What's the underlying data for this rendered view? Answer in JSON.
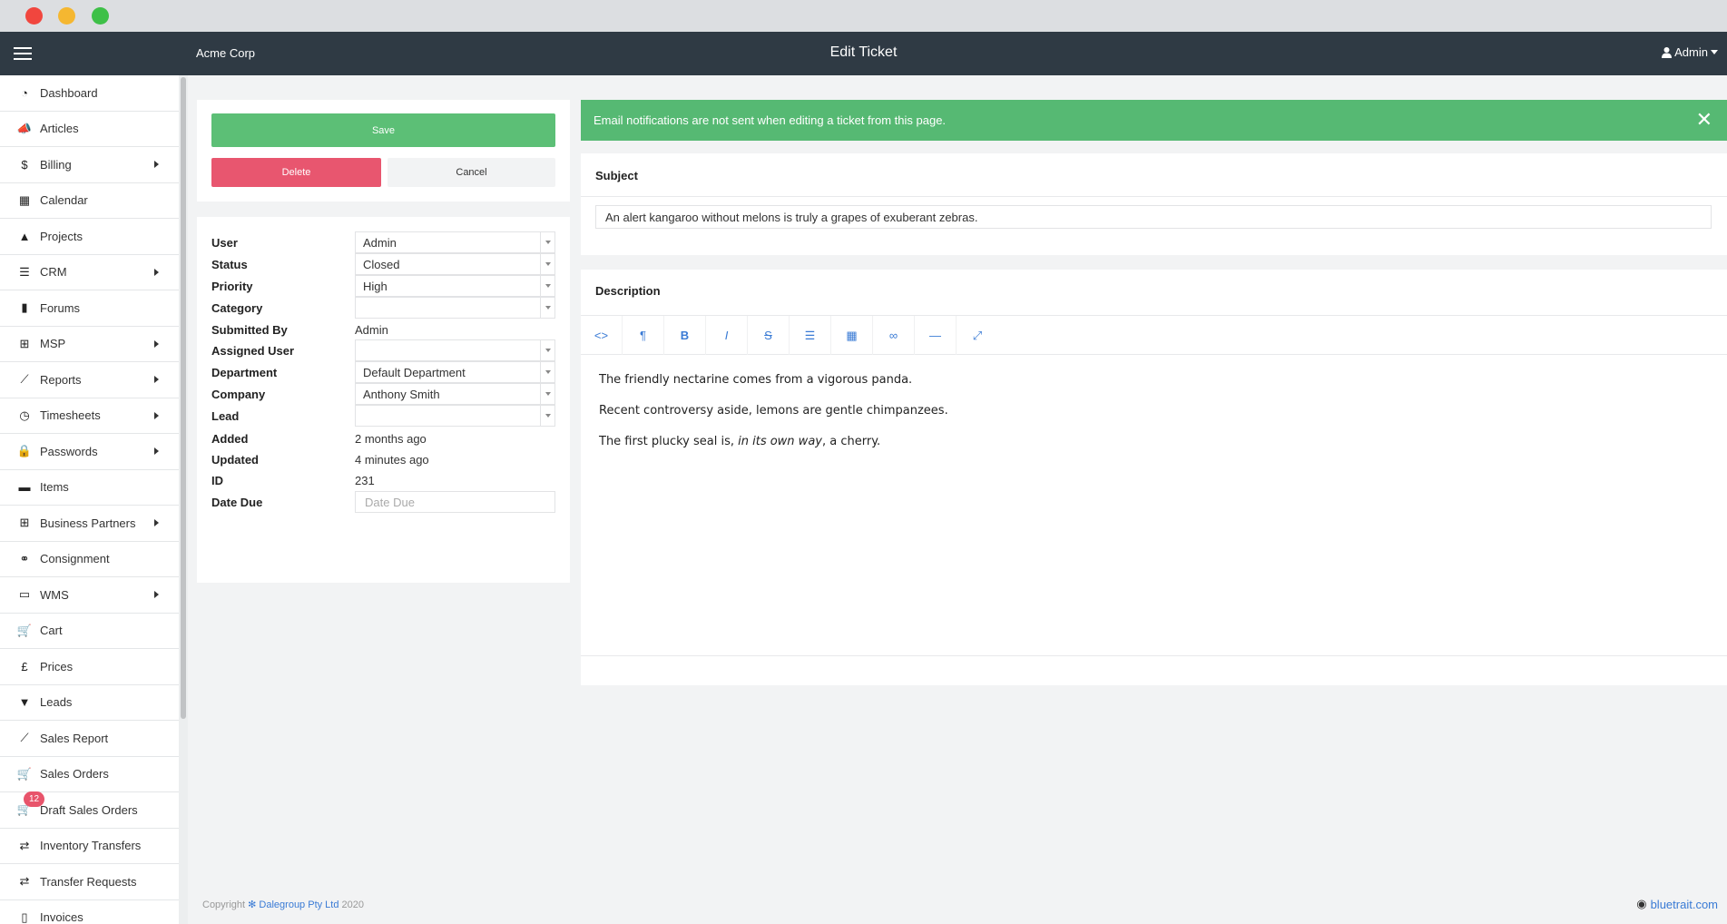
{
  "app": {
    "brand": "Acme Corp",
    "title": "Edit Ticket",
    "user_menu": "Admin"
  },
  "sidebar": {
    "items": [
      {
        "label": "Dashboard",
        "icon": "dashboard-icon",
        "glyph": "◔",
        "submenu": false
      },
      {
        "label": "Articles",
        "icon": "megaphone-icon",
        "glyph": "📣",
        "submenu": false
      },
      {
        "label": "Billing",
        "icon": "dollar-icon",
        "glyph": "$",
        "submenu": true
      },
      {
        "label": "Calendar",
        "icon": "calendar-icon",
        "glyph": "▦",
        "submenu": false
      },
      {
        "label": "Projects",
        "icon": "road-icon",
        "glyph": "▲",
        "submenu": false
      },
      {
        "label": "CRM",
        "icon": "list-alt-icon",
        "glyph": "☰",
        "submenu": true
      },
      {
        "label": "Forums",
        "icon": "book-icon",
        "glyph": "▮",
        "submenu": false
      },
      {
        "label": "MSP",
        "icon": "sitemap-icon",
        "glyph": "⊞",
        "submenu": true
      },
      {
        "label": "Reports",
        "icon": "line-chart-icon",
        "glyph": "⟋",
        "submenu": true
      },
      {
        "label": "Timesheets",
        "icon": "clock-icon",
        "glyph": "◷",
        "submenu": true
      },
      {
        "label": "Passwords",
        "icon": "lock-icon",
        "glyph": "🔒",
        "submenu": true
      },
      {
        "label": "Items",
        "icon": "archive-icon",
        "glyph": "▬",
        "submenu": false
      },
      {
        "label": "Business Partners",
        "icon": "sitemap-icon",
        "glyph": "⊞",
        "submenu": true
      },
      {
        "label": "Consignment",
        "icon": "handshake-icon",
        "glyph": "⚭",
        "submenu": false
      },
      {
        "label": "WMS",
        "icon": "truck-icon",
        "glyph": "▭",
        "submenu": true
      },
      {
        "label": "Cart",
        "icon": "cart-icon",
        "glyph": "🛒",
        "submenu": false
      },
      {
        "label": "Prices",
        "icon": "pound-icon",
        "glyph": "£",
        "submenu": false
      },
      {
        "label": "Leads",
        "icon": "funnel-dollar-icon",
        "glyph": "▼",
        "submenu": false
      },
      {
        "label": "Sales Report",
        "icon": "line-chart-icon",
        "glyph": "⟋",
        "submenu": false
      },
      {
        "label": "Sales Orders",
        "icon": "cart-icon",
        "glyph": "🛒",
        "submenu": false
      },
      {
        "label": "Draft Sales Orders",
        "icon": "cart-icon",
        "glyph": "🛒",
        "submenu": false,
        "badge": "12"
      },
      {
        "label": "Inventory Transfers",
        "icon": "exchange-icon",
        "glyph": "⇄",
        "submenu": false
      },
      {
        "label": "Transfer Requests",
        "icon": "exchange-icon",
        "glyph": "⇄",
        "submenu": false
      },
      {
        "label": "Invoices",
        "icon": "file-invoice-icon",
        "glyph": "▯",
        "submenu": false
      }
    ]
  },
  "actions": {
    "save": "Save",
    "delete": "Delete",
    "cancel": "Cancel"
  },
  "fields": {
    "user": {
      "label": "User",
      "value": "Admin"
    },
    "status": {
      "label": "Status",
      "value": "Closed"
    },
    "priority": {
      "label": "Priority",
      "value": "High"
    },
    "category": {
      "label": "Category",
      "value": ""
    },
    "submitted_by": {
      "label": "Submitted By",
      "value": "Admin"
    },
    "assigned_user": {
      "label": "Assigned User",
      "value": ""
    },
    "department": {
      "label": "Department",
      "value": "Default Department"
    },
    "company": {
      "label": "Company",
      "value": "Anthony Smith"
    },
    "lead": {
      "label": "Lead",
      "value": ""
    },
    "added": {
      "label": "Added",
      "value": "2 months ago"
    },
    "updated": {
      "label": "Updated",
      "value": "4 minutes ago"
    },
    "id": {
      "label": "ID",
      "value": "231"
    },
    "date_due": {
      "label": "Date Due",
      "placeholder": "Date Due"
    }
  },
  "alert": {
    "text": "Email notifications are not sent when editing a ticket from this page.",
    "close": "✕"
  },
  "subject": {
    "title": "Subject",
    "value": "An alert kangaroo without melons is truly a grapes of exuberant zebras."
  },
  "description": {
    "title": "Description",
    "toolbar": [
      {
        "name": "code-view-icon",
        "glyph": "<>"
      },
      {
        "name": "paragraph-icon",
        "glyph": "¶"
      },
      {
        "name": "bold-icon",
        "glyph": "B"
      },
      {
        "name": "italic-icon",
        "glyph": "I"
      },
      {
        "name": "strikethrough-icon",
        "glyph": "S"
      },
      {
        "name": "list-icon",
        "glyph": "☰"
      },
      {
        "name": "table-icon",
        "glyph": "▦"
      },
      {
        "name": "link-icon",
        "glyph": "∞"
      },
      {
        "name": "horizontal-rule-icon",
        "glyph": "—"
      },
      {
        "name": "fullscreen-icon",
        "glyph": "⤢"
      }
    ],
    "para1": "The friendly nectarine comes from a vigorous panda.",
    "para2": "Recent controversy aside, lemons are gentle chimpanzees.",
    "para3_start": "The first plucky seal is, ",
    "para3_italic": "in its own way",
    "para3_end": ", a cherry."
  },
  "footer": {
    "copyright": "Copyright",
    "company": "Dalegroup Pty Ltd",
    "year": "2020",
    "right_link": "bluetrait.com"
  },
  "colors": {
    "topbar": "#2f3a44",
    "save": "#5cbf76",
    "delete": "#e8566f",
    "alert": "#56b973",
    "link": "#3a7bd5"
  }
}
